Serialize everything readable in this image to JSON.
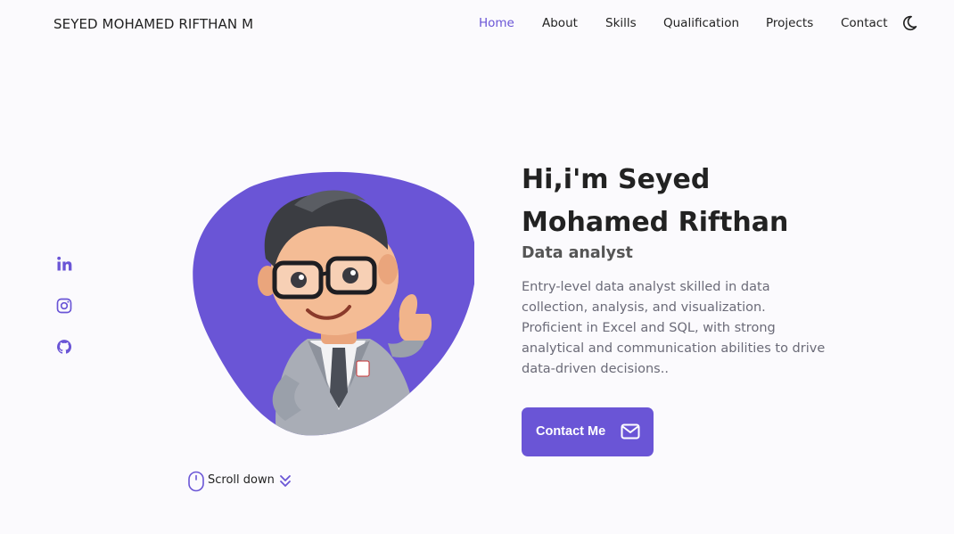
{
  "header": {
    "logo": "SEYED MOHAMED RIFTHAN M",
    "nav": [
      {
        "label": "Home",
        "active": true
      },
      {
        "label": "About",
        "active": false
      },
      {
        "label": "Skills",
        "active": false
      },
      {
        "label": "Qualification",
        "active": false
      },
      {
        "label": "Projects",
        "active": false
      },
      {
        "label": "Contact",
        "active": false
      }
    ],
    "theme_icon": "moon-icon"
  },
  "socials": [
    {
      "icon": "linkedin-icon"
    },
    {
      "icon": "instagram-icon"
    },
    {
      "icon": "github-icon"
    }
  ],
  "hero": {
    "title": "Hi,i'm Seyed Mohamed Rifthan",
    "subtitle": "Data analyst",
    "description": "Entry-level data analyst skilled in data collection, analysis, and visualization. Proficient in Excel and SQL, with strong analytical and communication abilities to drive data-driven decisions..",
    "cta_label": "Contact Me",
    "cta_icon": "mail-icon",
    "image": "avatar"
  },
  "scroll": {
    "label": "Scroll down",
    "icon": "mouse-icon",
    "arrow_icon": "double-chevron-down-icon"
  },
  "colors": {
    "accent": "#6a55d6",
    "background": "#fbfafd",
    "text": "#222222",
    "muted": "#6b6b78"
  }
}
